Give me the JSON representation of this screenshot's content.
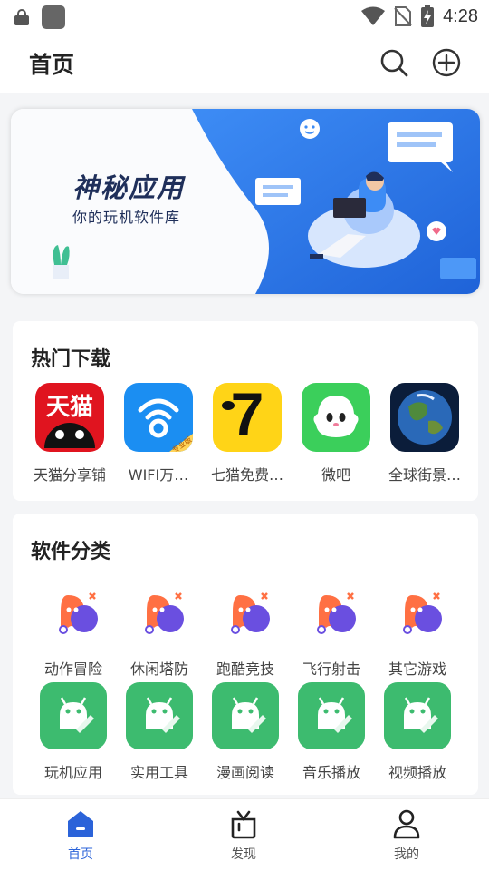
{
  "status_bar": {
    "time": "4:28"
  },
  "header": {
    "title": "首页"
  },
  "banner": {
    "title": "神秘应用",
    "subtitle": "你的玩机软件库"
  },
  "hot": {
    "title": "热门下载",
    "items": [
      {
        "label": "天猫分享铺",
        "icon": "tmall-icon",
        "icon_text": "天猫"
      },
      {
        "label": "WIFI万…",
        "icon": "wifi-master-icon",
        "badge": "专业版"
      },
      {
        "label": "七猫免费…",
        "icon": "qimao-icon",
        "icon_text": "7"
      },
      {
        "label": "微吧",
        "icon": "weiba-icon"
      },
      {
        "label": "全球街景…",
        "icon": "earth-icon"
      }
    ]
  },
  "categories": {
    "title": "软件分类",
    "games": [
      {
        "label": "动作冒险"
      },
      {
        "label": "休闲塔防"
      },
      {
        "label": "跑酷竞技"
      },
      {
        "label": "飞行射击"
      },
      {
        "label": "其它游戏"
      }
    ],
    "apps": [
      {
        "label": "玩机应用"
      },
      {
        "label": "实用工具"
      },
      {
        "label": "漫画阅读"
      },
      {
        "label": "音乐播放"
      },
      {
        "label": "视频播放"
      }
    ]
  },
  "nav": {
    "items": [
      {
        "label": "首页",
        "active": true
      },
      {
        "label": "发现",
        "active": false
      },
      {
        "label": "我的",
        "active": false
      }
    ]
  },
  "colors": {
    "accent": "#2b63d9",
    "green": "#3dbb6f",
    "game_orange": "#ff7043",
    "game_purple": "#6a4fe0"
  }
}
